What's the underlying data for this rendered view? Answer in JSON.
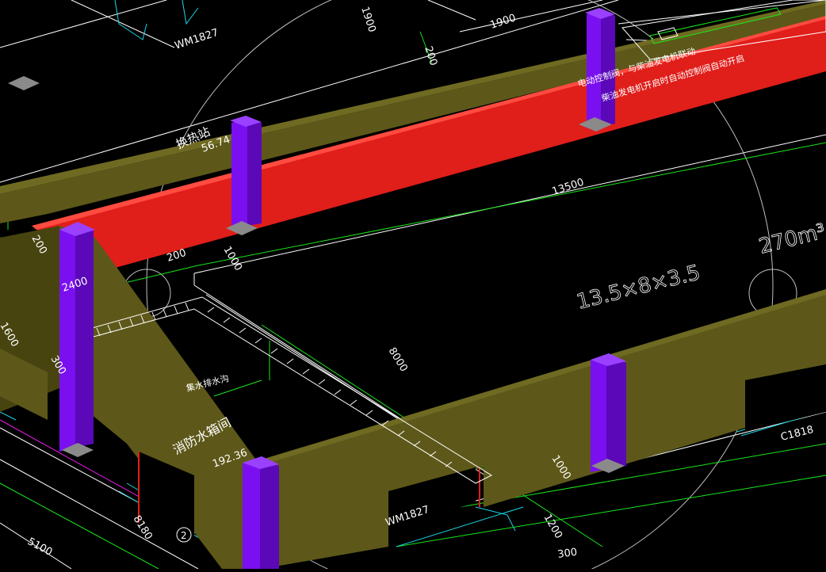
{
  "colors": {
    "background": "#000000",
    "wall": "#5d5819",
    "wall_dark": "#48440f",
    "wall_top": "#6f6a22",
    "duct_red": "#e01e1a",
    "column_purple": "#7a10f0",
    "column_purple_dark": "#5a08b8",
    "grid_green": "#19e619",
    "line_white": "#ffffff",
    "dim_white": "#e8e8e8",
    "cyan": "#19d7e6",
    "magenta": "#e619e6",
    "pad_gray": "#8a8a8a"
  },
  "labels": {
    "wm1827_top": "WM1827",
    "dim_1900_top": "1900",
    "dim_1900": "1900",
    "dim_200_top": "200",
    "duct_note_1": "电动控制阀，与柴油发电机联动",
    "duct_note_2": "柴油发电机开启时自动控制阀自动开启",
    "room_exchange": "换热站",
    "room_exchange_area": "56.74",
    "dim_13500": "13500",
    "dim_200_left": "200",
    "dim_200_mid": "200",
    "dim_1000_mid": "1000",
    "dim_2400": "2400",
    "tank_size": "13.5×8×3.5",
    "tank_volume": "270m³",
    "dim_1600": "1600",
    "dim_300": "300",
    "drain_trench": "集水排水沟",
    "dim_8000": "8000",
    "room_fire_tank": "消防水箱间",
    "room_fire_tank_area": "192.36",
    "c1818": "C1818",
    "dim_1000_right": "1000",
    "wm1827_bottom": "WM1827",
    "dim_5100": "5100",
    "dim_8180": "8180",
    "axis_2": "2",
    "dim_1200": "1200",
    "dim_300_bottom": "300"
  }
}
